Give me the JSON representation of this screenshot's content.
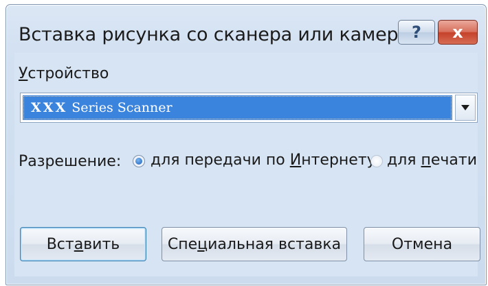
{
  "window": {
    "title": "Вставка рисунка со сканера или камеры",
    "help_glyph": "?",
    "close_glyph": "x",
    "help_icon": "question-mark",
    "close_icon": "x-mark"
  },
  "device": {
    "label": "Устройство",
    "selected": "XXX Series Scanner",
    "dropdown_icon": "triangle-down"
  },
  "resolution": {
    "label": "Разрешение:",
    "options": [
      {
        "label": "для передачи по Интернету",
        "checked": true
      },
      {
        "label": "для печати",
        "checked": false
      }
    ]
  },
  "buttons": {
    "insert": "Вставить",
    "special_insert": "Специальная вставка",
    "cancel": "Отмена"
  },
  "colors": {
    "selection": "#3b84dd",
    "close_button": "#c5412a",
    "dialog_background": "#d7e4f3",
    "default_button_border": "#3c7fb1"
  }
}
